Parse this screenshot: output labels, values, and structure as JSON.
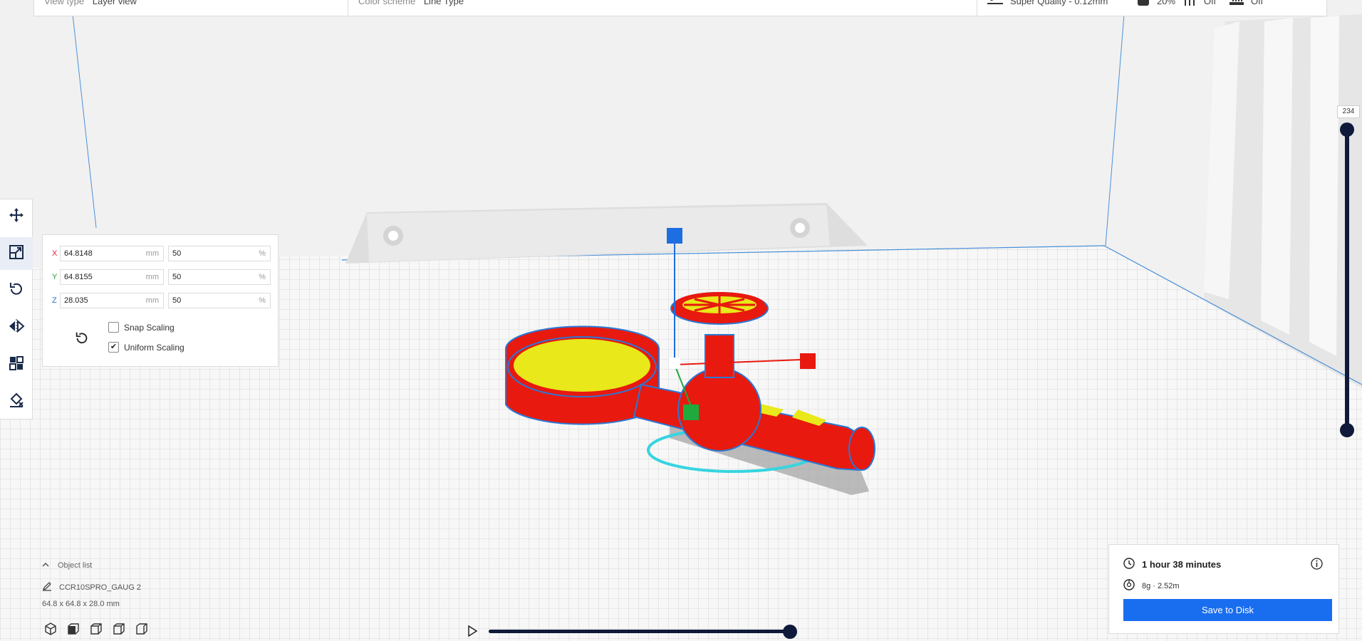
{
  "topbar": {
    "view_type_label": "View type",
    "view_type_value": "Layer view",
    "color_scheme_label": "Color scheme",
    "color_scheme_value": "Line Type",
    "profile_value": "Super Quality - 0.12mm",
    "infill_value": "20%",
    "support_value": "Off",
    "adhesion_value": "Off"
  },
  "toolbar": {
    "tools": [
      {
        "name": "move-tool",
        "icon": "move-icon"
      },
      {
        "name": "scale-tool",
        "icon": "scale-icon"
      },
      {
        "name": "rotate-tool",
        "icon": "rotate-icon"
      },
      {
        "name": "mirror-tool",
        "icon": "mirror-icon"
      },
      {
        "name": "per-model-settings-tool",
        "icon": "per-model-settings-icon"
      },
      {
        "name": "support-blocker-tool",
        "icon": "support-blocker-icon"
      }
    ],
    "active_tool": "scale-tool"
  },
  "scale_panel": {
    "x": {
      "axis": "X",
      "mm": "64.8148",
      "mm_unit": "mm",
      "pct": "50",
      "pct_unit": "%"
    },
    "y": {
      "axis": "Y",
      "mm": "64.8155",
      "mm_unit": "mm",
      "pct": "50",
      "pct_unit": "%"
    },
    "z": {
      "axis": "Z",
      "mm": "28.035",
      "mm_unit": "mm",
      "pct": "50",
      "pct_unit": "%"
    },
    "snap_scaling": {
      "label": "Snap Scaling",
      "checked": false
    },
    "uniform_scaling": {
      "label": "Uniform Scaling",
      "checked": true
    }
  },
  "layer_slider": {
    "current_layer": "234"
  },
  "object_list": {
    "header": "Object list",
    "object_name": "CCR10SPRO_GAUG 2",
    "dimensions": "64.8 x 64.8 x 28.0 mm"
  },
  "print_info": {
    "time": "1 hour 38 minutes",
    "material": "8g · 2.52m",
    "save_label": "Save to Disk"
  },
  "colors": {
    "accent": "#196ef0",
    "slider": "#0f1a3a",
    "model_wall": "#e8190f",
    "model_infill": "#e8e81a",
    "skirt": "#35d5e0"
  }
}
